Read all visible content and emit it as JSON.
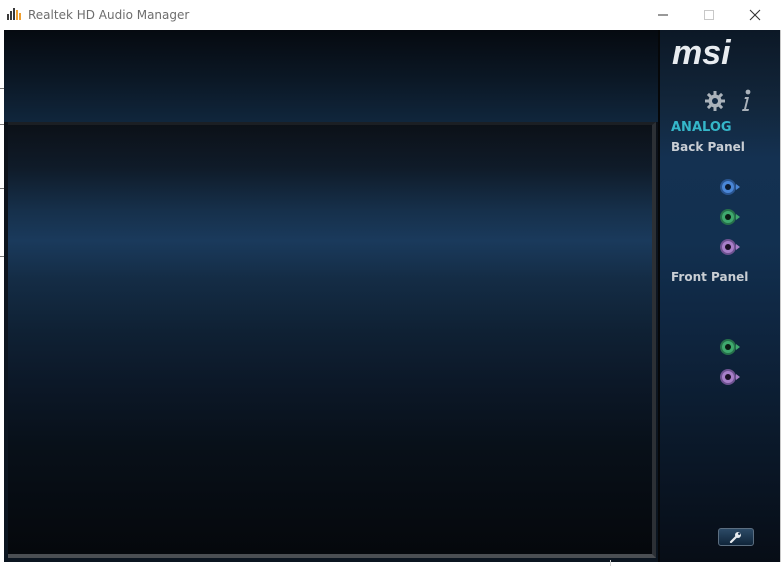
{
  "window": {
    "title": "Realtek HD Audio Manager",
    "icon": "realtek-audio-icon",
    "controls": [
      "minimize-icon",
      "maximize-icon",
      "close-icon"
    ]
  },
  "sidebar": {
    "brand": "msi",
    "settings_icon": "gear-icon",
    "info_icon": "info-icon",
    "section_title": "ANALOG",
    "back_panel": {
      "label": "Back Panel",
      "jacks": [
        {
          "name": "line-in-jack",
          "color": "#4a86d6"
        },
        {
          "name": "line-out-jack",
          "color": "#3fa86e"
        },
        {
          "name": "mic-in-jack",
          "color": "#a77fc8"
        }
      ]
    },
    "front_panel": {
      "label": "Front Panel",
      "jacks": [
        {
          "name": "headphone-jack",
          "color": "#3fa86e"
        },
        {
          "name": "front-mic-jack",
          "color": "#a77fc8"
        }
      ]
    },
    "tools_icon": "wrench-icon"
  },
  "colors": {
    "accent": "#35b6c9",
    "panel_dark": "#0b1520",
    "panel_highlight": "#1a3a5c"
  }
}
